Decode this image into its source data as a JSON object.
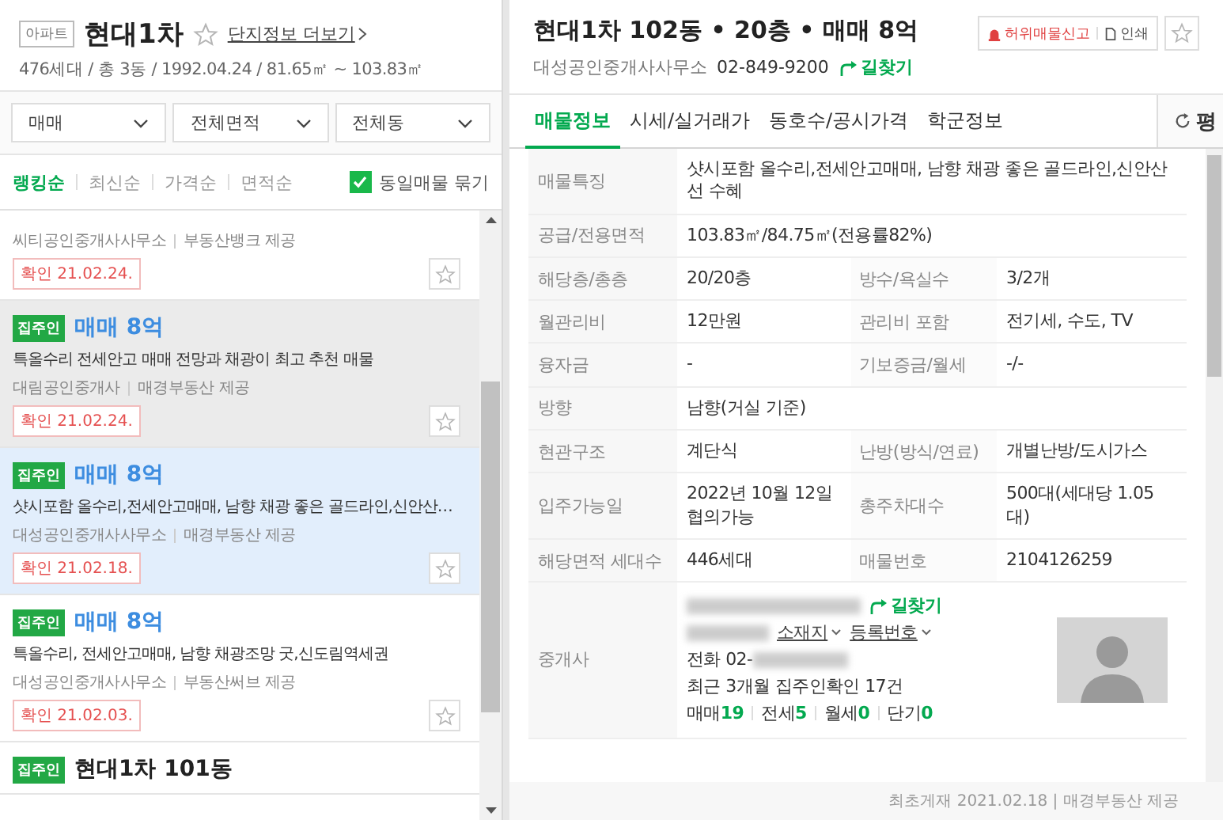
{
  "complex": {
    "type_badge": "아파트",
    "name": "현대1차",
    "more_link": "단지정보 더보기",
    "summary": "476세대 / 총 3동 / 1992.04.24 / 81.65㎡ ~ 103.83㎡"
  },
  "filters": [
    {
      "label": "매매"
    },
    {
      "label": "전체면적"
    },
    {
      "label": "전체동"
    }
  ],
  "sort_options": [
    {
      "label": "랭킹순",
      "selected": true
    },
    {
      "label": "최신순",
      "selected": false
    },
    {
      "label": "가격순",
      "selected": false
    },
    {
      "label": "면적순",
      "selected": false
    }
  ],
  "group_same": {
    "label": "동일매물 묶기",
    "checked": true
  },
  "listings": [
    {
      "agency": "씨티공인중개사사무소",
      "provider": "부동산뱅크 제공",
      "confirmed": "확인 21.02.24.",
      "selected": false,
      "hovered": false
    },
    {
      "owner_badge": "집주인",
      "kind": "price",
      "title": "매매 8억",
      "description": "특올수리 전세안고 매매 전망과 채광이 최고 추천 매물",
      "agency": "대림공인중개사",
      "provider": "매경부동산 제공",
      "confirmed": "확인 21.02.24.",
      "selected": false,
      "hovered": true
    },
    {
      "owner_badge": "집주인",
      "kind": "price",
      "title": "매매 8억",
      "description": "샷시포함 올수리,전세안고매매, 남향 채광 좋은 골드라인,신안산…",
      "agency": "대성공인중개사사무소",
      "provider": "매경부동산 제공",
      "confirmed": "확인 21.02.18.",
      "selected": true,
      "hovered": false
    },
    {
      "owner_badge": "집주인",
      "kind": "price",
      "title": "매매 8억",
      "description": "특올수리, 전세안고매매, 남향 채광조망 굿,신도림역세권",
      "agency": "대성공인중개사사무소",
      "provider": "부동산써브 제공",
      "confirmed": "확인 21.02.03.",
      "selected": false,
      "hovered": false
    },
    {
      "owner_badge": "집주인",
      "kind": "name",
      "title": "현대1차 101동",
      "selected": false,
      "hovered": false
    }
  ],
  "detail": {
    "title": "현대1차 102동 • 20층 • 매매 8억",
    "agency": "대성공인중개사사무소",
    "phone": "02-849-9200",
    "directions": "길찾기",
    "report_button": "허위매물신고",
    "print_button": "인쇄"
  },
  "tabs": [
    {
      "label": "매물정보",
      "selected": true
    },
    {
      "label": "시세/실거래가",
      "selected": false
    },
    {
      "label": "동호수/공시가격",
      "selected": false
    },
    {
      "label": "학군정보",
      "selected": false
    }
  ],
  "unit_toggle": "평",
  "rows": [
    {
      "label": "매물특징",
      "value": "샷시포함 올수리,전세안고매매, 남향 채광 좋은 골드라인,신안산선 수혜"
    },
    {
      "label": "공급/전용면적",
      "value": "103.83㎡/84.75㎡(전용률82%)"
    },
    {
      "label": "해당층/총층",
      "value": "20/20층",
      "label2": "방수/욕실수",
      "value2": "3/2개"
    },
    {
      "label": "월관리비",
      "value": "12만원",
      "label2": "관리비 포함",
      "value2": "전기세, 수도, TV"
    },
    {
      "label": "융자금",
      "value": "-",
      "label2": "기보증금/월세",
      "value2": "-/-"
    },
    {
      "label": "방향",
      "value": "남향(거실 기준)"
    },
    {
      "label": "현관구조",
      "value": "계단식",
      "label2": "난방(방식/연료)",
      "value2": "개별난방/도시가스"
    },
    {
      "label": "입주가능일",
      "value": "2022년 10월 12일 협의가능",
      "label2": "총주차대수",
      "value2": "500대(세대당 1.05대)"
    },
    {
      "label": "해당면적 세대수",
      "value": "446세대",
      "label2": "매물번호",
      "value2": "2104126259"
    }
  ],
  "broker": {
    "label": "중개사",
    "directions": "길찾기",
    "address_link": "소재지",
    "registration_link": "등록번호",
    "phone": "전화 02-",
    "recent": "최근 3개월 집주인확인 17건",
    "counts": [
      {
        "label": "매매",
        "value": "19"
      },
      {
        "label": "전세",
        "value": "5"
      },
      {
        "label": "월세",
        "value": "0"
      },
      {
        "label": "단기",
        "value": "0"
      }
    ]
  },
  "footer": "최초게재 2021.02.18 | 매경부동산 제공"
}
